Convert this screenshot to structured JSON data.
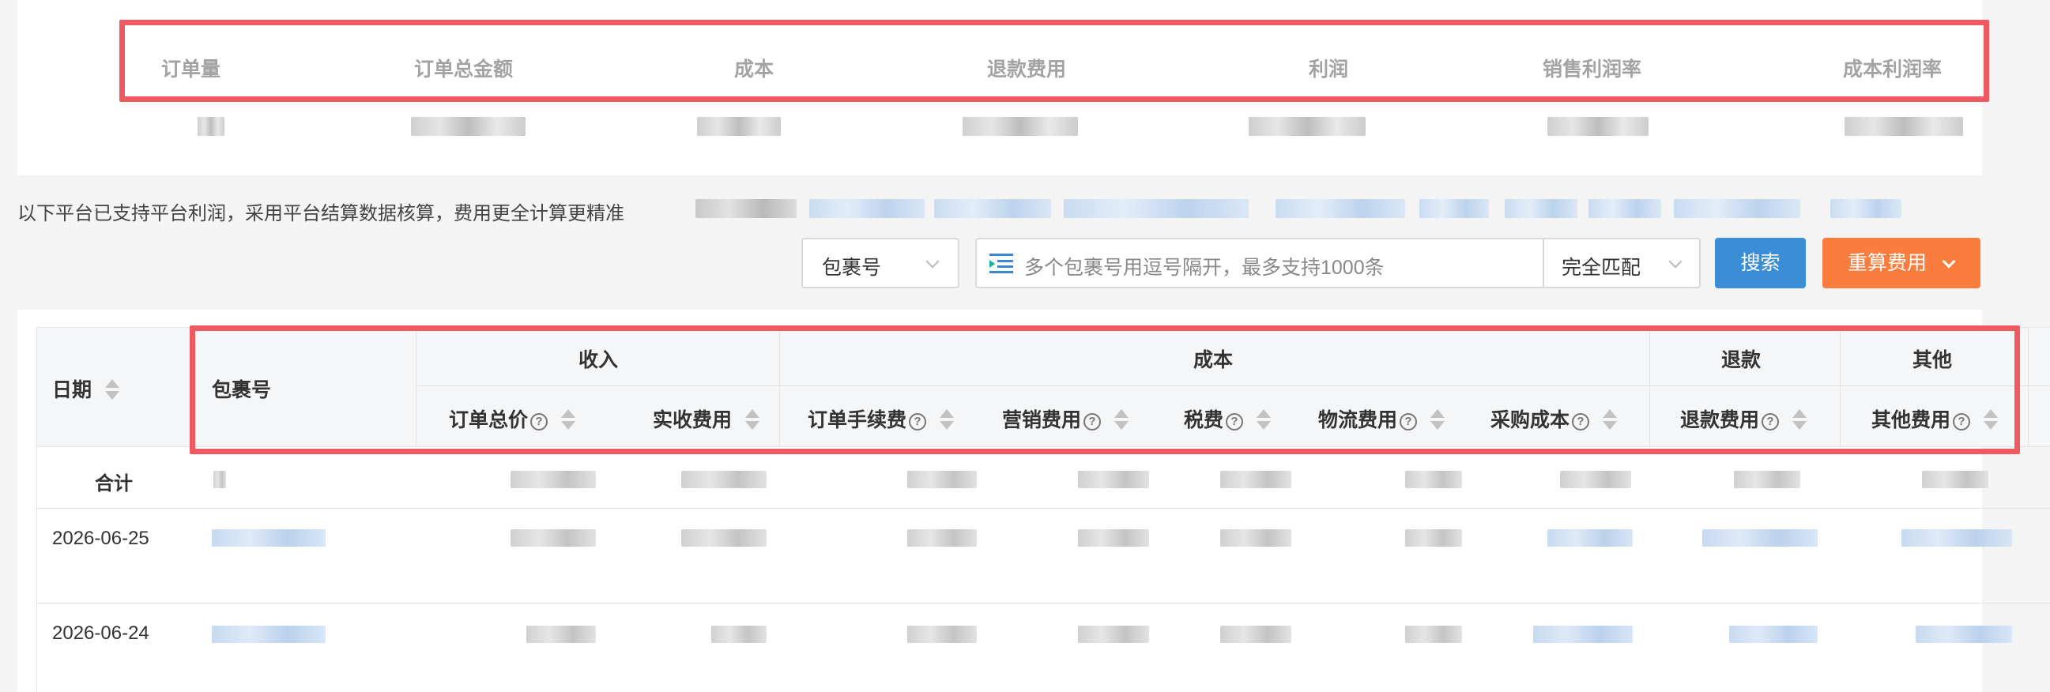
{
  "summary": {
    "labels": [
      "订单量",
      "订单总金额",
      "成本",
      "退款费用",
      "利润",
      "销售利润率",
      "成本利润率"
    ]
  },
  "notice": {
    "text": "以下平台已支持平台利润，采用平台结算数据核算，费用更全计算更精准"
  },
  "toolbar": {
    "field_select": "包裹号",
    "search_placeholder": "多个包裹号用逗号隔开，最多支持1000条",
    "match_select": "完全匹配",
    "search_button": "搜索",
    "recalc_button": "重算费用",
    "recalc_caret": "⌄"
  },
  "table": {
    "headers": {
      "date": "日期",
      "package": "包裹号",
      "group_income": "收入",
      "group_cost": "成本",
      "group_refund": "退款",
      "group_other": "其他",
      "order_total": "订单总价",
      "received_fee": "实收费用",
      "order_fee": "订单手续费",
      "marketing_fee": "营销费用",
      "tax": "税费",
      "logistics_fee": "物流费用",
      "purchase_cost": "采购成本",
      "refund_fee": "退款费用",
      "other_fee": "其他费用"
    },
    "help_glyph": "?",
    "total_label": "合计",
    "rows": [
      {
        "date": "2026-06-25"
      },
      {
        "date": "2026-06-24"
      }
    ]
  }
}
